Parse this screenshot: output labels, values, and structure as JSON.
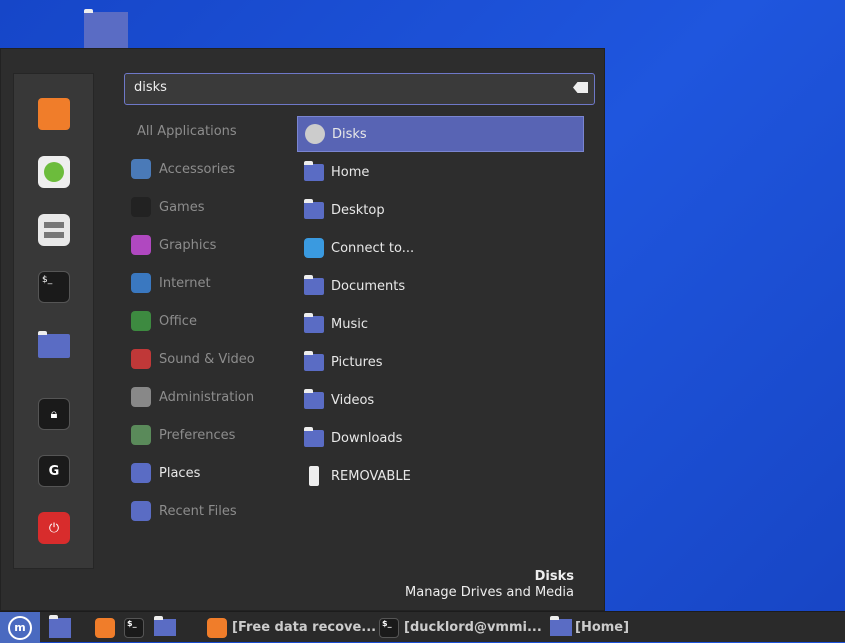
{
  "search": {
    "value": "disks"
  },
  "categories": [
    "All Applications",
    "Accessories",
    "Games",
    "Graphics",
    "Internet",
    "Office",
    "Sound & Video",
    "Administration",
    "Preferences",
    "Places",
    "Recent Files"
  ],
  "category_colors": [
    "",
    "#4a7ab8",
    "#222222",
    "#b048c0",
    "#3a78c0",
    "#3d8a40",
    "#c03838",
    "#888888",
    "#5a8a5a",
    "#5a6cc4",
    "#5a6cc4"
  ],
  "results": [
    {
      "label": "Disks",
      "icon": "disks-icon"
    },
    {
      "label": "Home",
      "icon": "home-folder-icon"
    },
    {
      "label": "Desktop",
      "icon": "desktop-folder-icon"
    },
    {
      "label": "Connect to...",
      "icon": "cloud-icon"
    },
    {
      "label": "Documents",
      "icon": "documents-folder-icon"
    },
    {
      "label": "Music",
      "icon": "music-folder-icon"
    },
    {
      "label": "Pictures",
      "icon": "pictures-folder-icon"
    },
    {
      "label": "Videos",
      "icon": "videos-folder-icon"
    },
    {
      "label": "Downloads",
      "icon": "downloads-folder-icon"
    },
    {
      "label": "REMOVABLE",
      "icon": "usb-drive-icon"
    }
  ],
  "description": {
    "title": "Disks",
    "subtitle": "Manage Drives and Media"
  },
  "favorites": [
    "firefox-icon",
    "software-manager-icon",
    "settings-icon",
    "terminal-icon",
    "files-icon",
    "lock-icon",
    "logout-icon",
    "power-icon"
  ],
  "taskbar": {
    "windows": [
      "[Free data recove...",
      "[ducklord@vmmi...",
      "[Home]"
    ],
    "term_glyph": "$_"
  },
  "colors": {
    "accent": "#5864b4",
    "panel": "#2d2d2d"
  }
}
